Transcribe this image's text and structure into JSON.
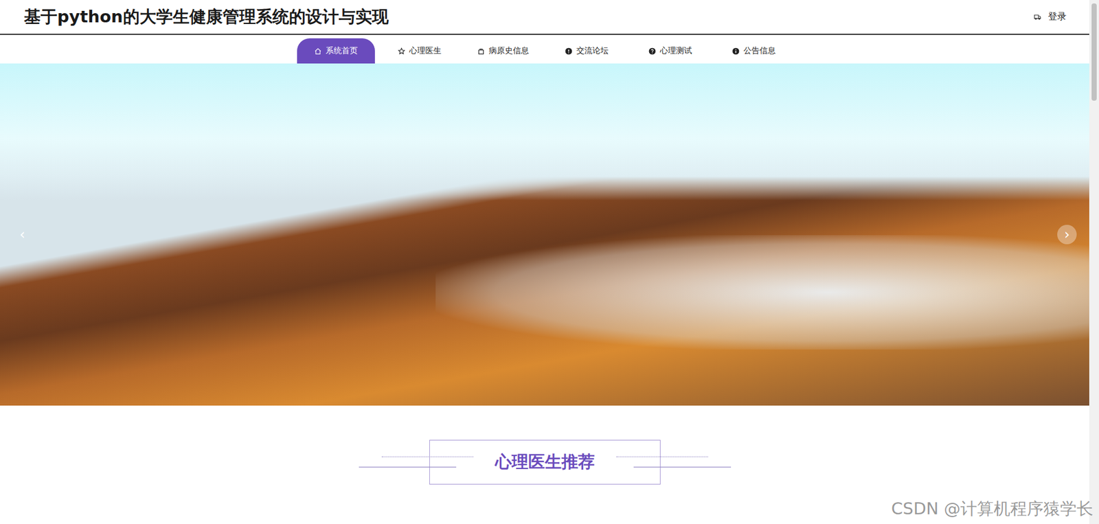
{
  "header": {
    "title": "基于python的大学生健康管理系统的设计与实现",
    "login": "登录"
  },
  "nav": [
    {
      "label": "系统首页",
      "selected": true
    },
    {
      "label": "心理医生",
      "selected": false
    },
    {
      "label": "病原史信息",
      "selected": false
    },
    {
      "label": "交流论坛",
      "selected": false
    },
    {
      "label": "心理测试",
      "selected": false
    },
    {
      "label": "公告信息",
      "selected": false
    }
  ],
  "banner": {
    "prev": "‹",
    "next": "›"
  },
  "section": {
    "title": "心理医生推荐"
  },
  "watermark": "CSDN @计算机程序猿学长"
}
